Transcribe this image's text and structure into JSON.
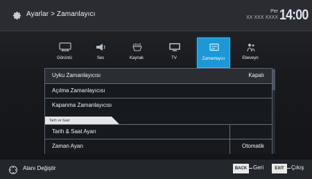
{
  "header": {
    "breadcrumb": "Ayarlar > Zamanlayıcı",
    "day": "Per",
    "date": "XX XXX XXXX",
    "time": "14:00"
  },
  "tabs": [
    {
      "label": "Görüntü",
      "icon": "picture-icon"
    },
    {
      "label": "Ses",
      "icon": "sound-icon"
    },
    {
      "label": "Kaynak",
      "icon": "source-icon"
    },
    {
      "label": "TV",
      "icon": "tv-icon"
    },
    {
      "label": "Zamanlayıcı",
      "icon": "timer-icon"
    },
    {
      "label": "Ebeveyn",
      "icon": "parental-icon"
    }
  ],
  "settings": {
    "rows": [
      {
        "label": "Uyku Zamanlayıcısı",
        "value": "Kapalı"
      },
      {
        "label": "Açılma Zamanlayıcısı",
        "value": ""
      },
      {
        "label": "Kapanma Zamanlayıcısı",
        "value": ""
      }
    ],
    "section_title": "Tarih ve Saat",
    "section_rows": [
      {
        "label": "Tarih & Saat Ayarı",
        "value": ""
      },
      {
        "label": "Zaman Ayarı",
        "value": "Otomatik"
      }
    ]
  },
  "footer": {
    "nav_hint": "Alanı Değiştir",
    "back_key": "BACK",
    "back_label": "Geri",
    "exit_key": "EXIT",
    "exit_label": "Çıkış"
  },
  "colors": {
    "active_tab": "#1b98d5",
    "background": "#15171a"
  }
}
